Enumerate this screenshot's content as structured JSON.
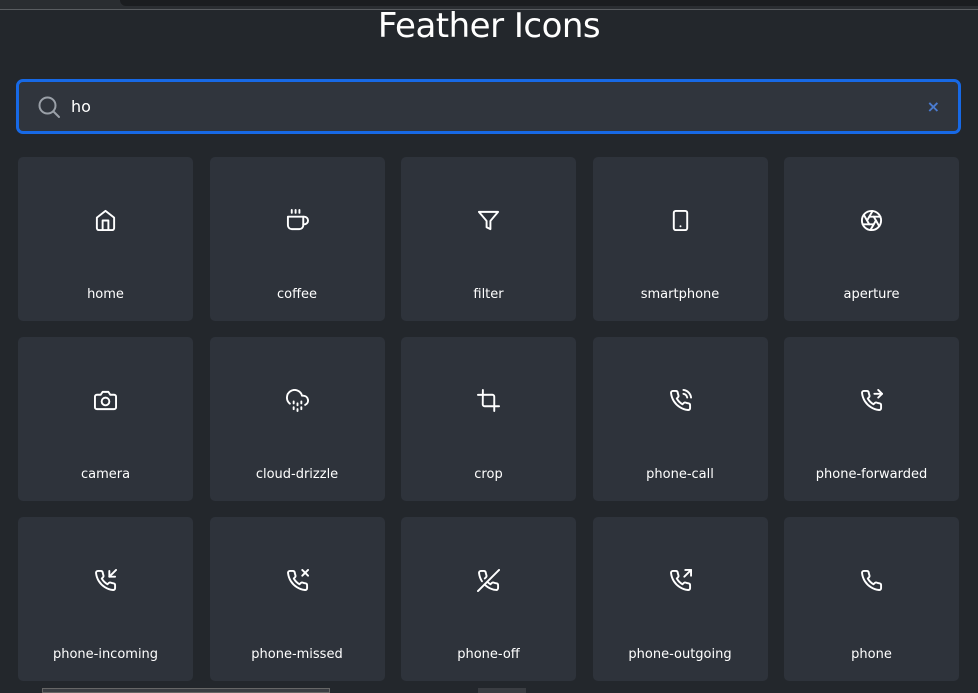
{
  "header": {
    "title": "Feather Icons"
  },
  "search": {
    "value": "ho",
    "clear_label": "×",
    "icon": "search-icon"
  },
  "colors": {
    "accent": "#1769e6",
    "card": "#2e333b",
    "background": "#23272c"
  },
  "icons": [
    {
      "label": "home",
      "icon": "home"
    },
    {
      "label": "coffee",
      "icon": "coffee"
    },
    {
      "label": "filter",
      "icon": "filter"
    },
    {
      "label": "smartphone",
      "icon": "smartphone"
    },
    {
      "label": "aperture",
      "icon": "aperture"
    },
    {
      "label": "camera",
      "icon": "camera"
    },
    {
      "label": "cloud-drizzle",
      "icon": "cloud-drizzle"
    },
    {
      "label": "crop",
      "icon": "crop"
    },
    {
      "label": "phone-call",
      "icon": "phone-call"
    },
    {
      "label": "phone-forwarded",
      "icon": "phone-forwarded"
    },
    {
      "label": "phone-incoming",
      "icon": "phone-incoming"
    },
    {
      "label": "phone-missed",
      "icon": "phone-missed"
    },
    {
      "label": "phone-off",
      "icon": "phone-off"
    },
    {
      "label": "phone-outgoing",
      "icon": "phone-outgoing"
    },
    {
      "label": "phone",
      "icon": "phone"
    }
  ]
}
